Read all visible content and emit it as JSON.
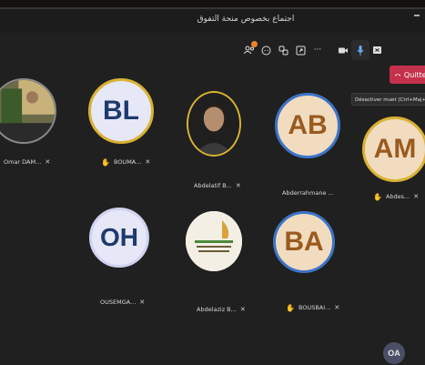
{
  "window": {
    "title": "اجتماع بخصوص منحة التفوق"
  },
  "toolbar": {
    "icons": [
      "people-icon",
      "chat-icon",
      "reactions-icon",
      "share-icon",
      "more-icon",
      "camera-icon",
      "mic-icon",
      "screen-share-icon"
    ],
    "more_label": "···",
    "quit_label": "Quitter",
    "tooltip": "Désactiver muet (Ctrl+Maj+M)"
  },
  "participants": [
    {
      "initials": "",
      "name": "Omar DAM...",
      "hand_raised": false,
      "mic_muted": true,
      "kind": "photo"
    },
    {
      "initials": "BL",
      "name": "BOUMA...",
      "hand_raised": true,
      "mic_muted": true,
      "kind": "initials"
    },
    {
      "initials": "",
      "name": "Abdelatif B...",
      "hand_raised": false,
      "mic_muted": true,
      "kind": "photo"
    },
    {
      "initials": "AB",
      "name": "Abderrahmane ...",
      "hand_raised": false,
      "mic_muted": false,
      "kind": "initials"
    },
    {
      "initials": "AM",
      "name": "Abdes...",
      "hand_raised": true,
      "mic_muted": true,
      "kind": "initials"
    },
    {
      "initials": "OH",
      "name": "OUSEMGA...",
      "hand_raised": false,
      "mic_muted": true,
      "kind": "initials"
    },
    {
      "initials": "",
      "name": "Abdelaziz B...",
      "hand_raised": false,
      "mic_muted": true,
      "kind": "logo"
    },
    {
      "initials": "BA",
      "name": "BOUSBAI...",
      "hand_raised": true,
      "mic_muted": true,
      "kind": "initials"
    }
  ],
  "self_avatar": {
    "initials": "OA"
  },
  "colors": {
    "quit": "#c4314b",
    "hand": "#f2b400",
    "active_ring_gold": "#d9b233",
    "active_ring_blue": "#3d74c8"
  }
}
